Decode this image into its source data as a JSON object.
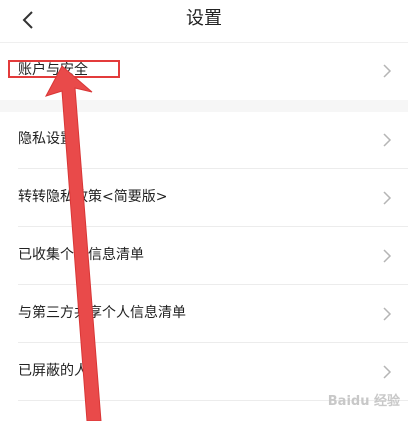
{
  "header": {
    "title": "设置"
  },
  "items": [
    {
      "label": "账户与安全"
    },
    {
      "label": "隐私设置"
    },
    {
      "label": "转转隐私政策<简要版>"
    },
    {
      "label": "已收集个人信息清单"
    },
    {
      "label": "与第三方共享个人信息清单"
    },
    {
      "label": "已屏蔽的人"
    }
  ],
  "annotation": {
    "highlight_color": "#e33b3b",
    "arrow_color": "#e94a4a"
  },
  "watermark": {
    "text": "Baidu 经验"
  }
}
